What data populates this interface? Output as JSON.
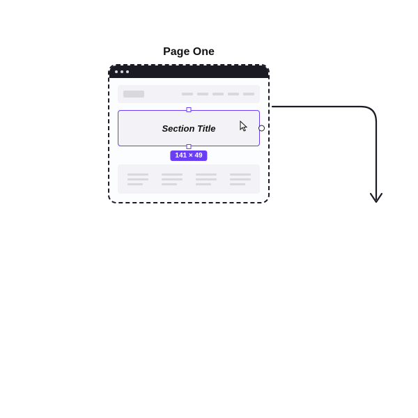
{
  "page": {
    "label": "Page One"
  },
  "section": {
    "title": "Section Title",
    "dimensions": "141 × 49"
  },
  "colors": {
    "accent": "#6a3ef5",
    "stroke": "#1b1b24",
    "placeholder": "#d9d8dd",
    "panel": "#f3f2f6"
  }
}
